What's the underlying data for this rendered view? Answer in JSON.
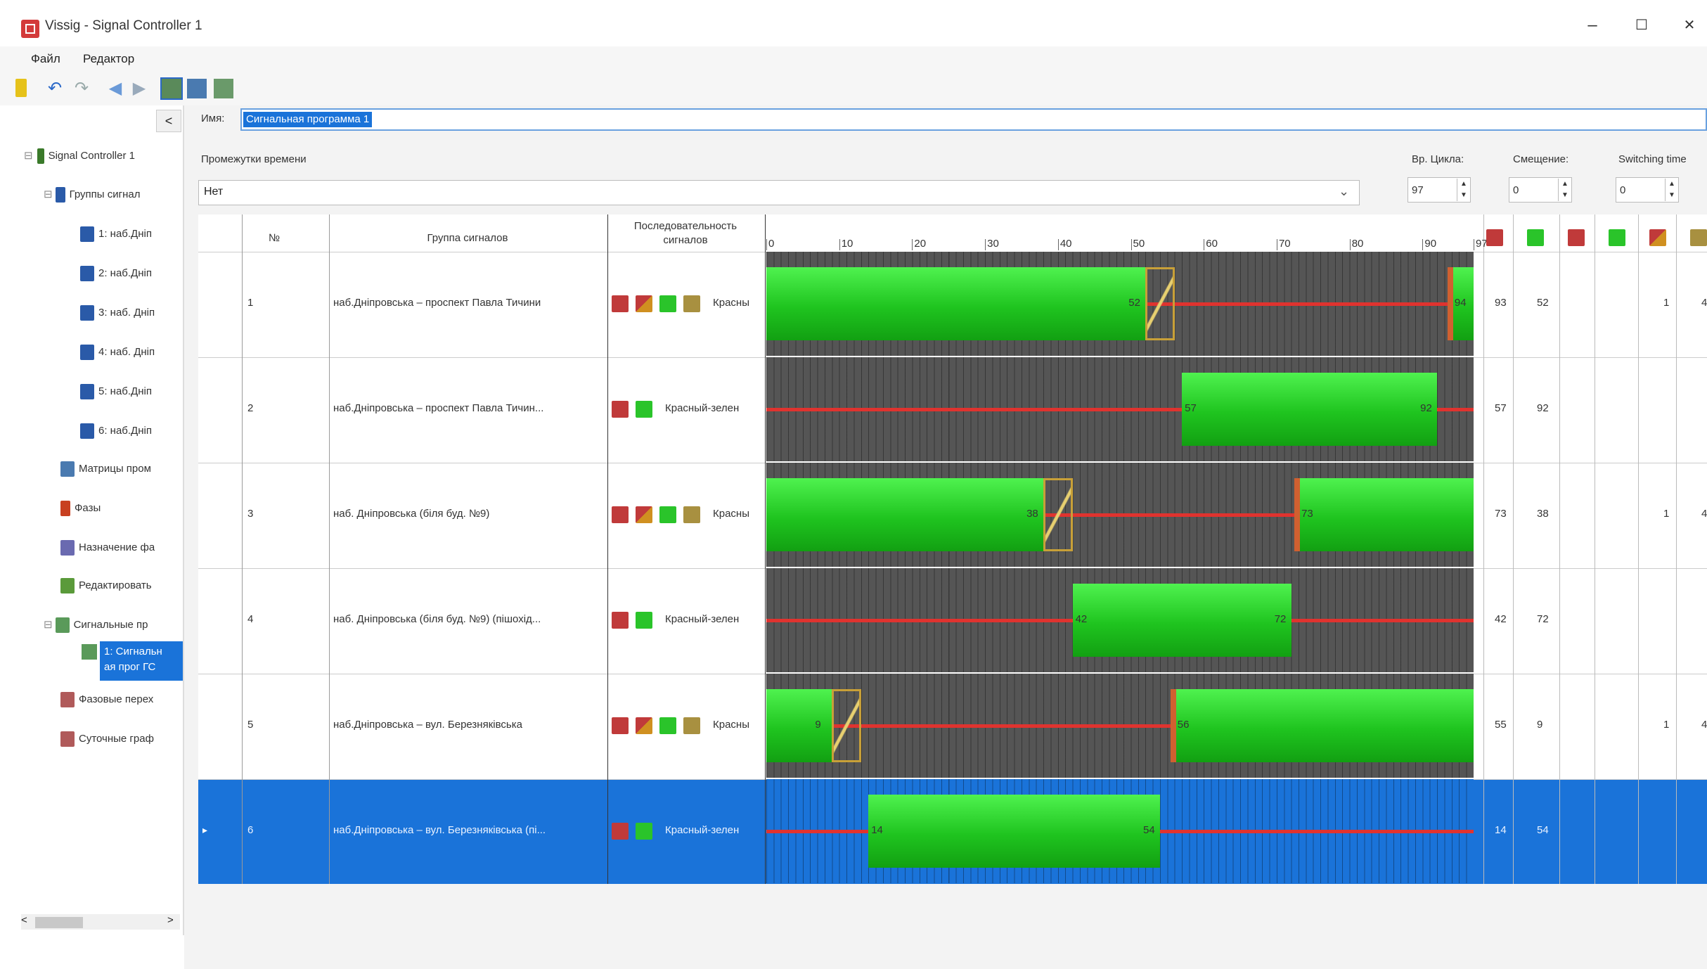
{
  "window": {
    "title": "Vissig - Signal Controller 1",
    "minimize": "–",
    "maximize": "☐",
    "close": "✕"
  },
  "menu": [
    "Файл",
    "Редактор"
  ],
  "tree": {
    "root": "Signal Controller 1",
    "signal_groups": "Группы сигнал",
    "groups": [
      "1: наб.Дніп",
      "2: наб.Дніп",
      "3: наб. Дніп",
      "4: наб. Дніп",
      "5: наб.Дніп",
      "6: наб.Дніп"
    ],
    "items": [
      "Матрицы пром",
      "Фазы",
      "Назначение фа",
      "Редактировать",
      "Сигнальные пр"
    ],
    "selected_program": [
      "1: Сигнальн",
      "ая прог ГС"
    ],
    "items2": [
      "Фазовые перех",
      "Суточные граф"
    ],
    "collapse": "<",
    "scroll_left": "<",
    "scroll_right": ">"
  },
  "form": {
    "name_label": "Имя:",
    "name_value": "Сигнальная программа 1",
    "time_periods_label": "Промежутки времени",
    "time_periods_value": "Нет",
    "cycle_label": "Вр. Цикла:",
    "cycle_value": "97",
    "offset_label": "Смещение:",
    "offset_value": "0",
    "switching_label": "Switching time",
    "switching_value": "0"
  },
  "columns": {
    "num": "№",
    "group": "Группа сигналов",
    "sequence": "Последовательность сигналов"
  },
  "timeline": {
    "max": 97,
    "ticks": [
      "0",
      "10",
      "20",
      "30",
      "40",
      "50",
      "60",
      "70",
      "80",
      "90",
      "97"
    ]
  },
  "colors": {
    "red": "#e0332f",
    "green": "#22c422",
    "amber": "#c8a038",
    "selection": "#1a73d9"
  },
  "rows": [
    {
      "num": "1",
      "name": "наб.Дніпровська – проспект Павла Тичини",
      "seq": "Красны",
      "seq_icons": [
        "red",
        "redamber",
        "green",
        "amber"
      ],
      "greens": [
        [
          0,
          52
        ],
        [
          94,
          97
        ]
      ],
      "yellows": [
        [
          52,
          56
        ]
      ],
      "amber_at": [
        93
      ],
      "labels": [
        {
          "v": "52",
          "at": 52,
          "side": "left"
        },
        {
          "v": "94",
          "at": 94,
          "side": "right"
        }
      ],
      "c1": "93",
      "c2": "52",
      "c5": "1",
      "c6": "4"
    },
    {
      "num": "2",
      "name": "наб.Дніпровська – проспект Павла Тичин...",
      "seq": "Красный-зелен",
      "seq_icons": [
        "red",
        "green"
      ],
      "greens": [
        [
          57,
          92
        ]
      ],
      "yellows": [],
      "amber_at": [],
      "labels": [
        {
          "v": "57",
          "at": 57,
          "side": "right"
        },
        {
          "v": "92",
          "at": 92,
          "side": "left"
        }
      ],
      "c1": "57",
      "c2": "92",
      "c5": "",
      "c6": ""
    },
    {
      "num": "3",
      "name": "наб. Дніпровська (біля буд. №9)",
      "seq": "Красны",
      "seq_icons": [
        "red",
        "redamber",
        "green",
        "amber"
      ],
      "greens": [
        [
          0,
          38
        ],
        [
          73,
          97
        ]
      ],
      "yellows": [
        [
          38,
          42
        ]
      ],
      "amber_at": [
        72
      ],
      "labels": [
        {
          "v": "38",
          "at": 38,
          "side": "left"
        },
        {
          "v": "73",
          "at": 73,
          "side": "right"
        }
      ],
      "c1": "73",
      "c2": "38",
      "c5": "1",
      "c6": "4"
    },
    {
      "num": "4",
      "name": "наб. Дніпровська (біля буд. №9) (пішохід...",
      "seq": "Красный-зелен",
      "seq_icons": [
        "red",
        "green"
      ],
      "greens": [
        [
          42,
          72
        ]
      ],
      "yellows": [],
      "amber_at": [],
      "labels": [
        {
          "v": "42",
          "at": 42,
          "side": "right"
        },
        {
          "v": "72",
          "at": 72,
          "side": "left"
        }
      ],
      "c1": "42",
      "c2": "72",
      "c5": "",
      "c6": ""
    },
    {
      "num": "5",
      "name": "наб.Дніпровська – вул. Березняківська",
      "seq": "Красны",
      "seq_icons": [
        "red",
        "redamber",
        "green",
        "amber"
      ],
      "greens": [
        [
          0,
          9
        ],
        [
          56,
          97
        ]
      ],
      "yellows": [
        [
          9,
          13
        ]
      ],
      "amber_at": [
        55
      ],
      "labels": [
        {
          "v": "9",
          "at": 9,
          "side": "left"
        },
        {
          "v": "56",
          "at": 56,
          "side": "right"
        }
      ],
      "c1": "55",
      "c2": "9",
      "c5": "1",
      "c6": "4"
    },
    {
      "num": "6",
      "name": "наб.Дніпровська – вул. Березняківська (пі...",
      "seq": "Красный-зелен",
      "seq_icons": [
        "red",
        "green"
      ],
      "greens": [
        [
          14,
          54
        ]
      ],
      "yellows": [],
      "amber_at": [],
      "labels": [
        {
          "v": "14",
          "at": 14,
          "side": "right"
        },
        {
          "v": "54",
          "at": 54,
          "side": "left"
        }
      ],
      "c1": "14",
      "c2": "54",
      "c5": "",
      "c6": "",
      "selected": true
    }
  ],
  "row_marker": "▸"
}
